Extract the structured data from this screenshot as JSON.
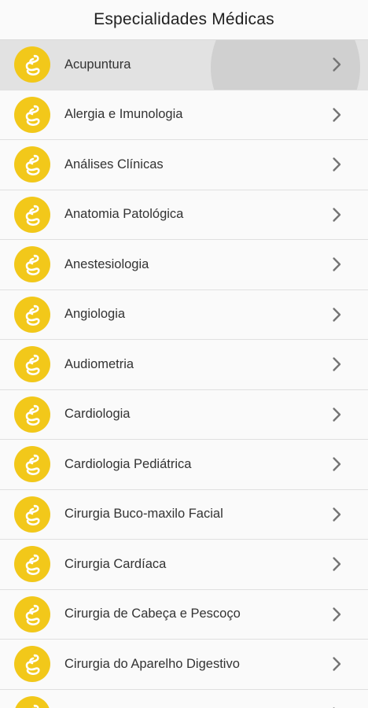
{
  "appbar": {
    "title": "Especialidades Médicas"
  },
  "colors": {
    "accent": "#f2c81a",
    "pressed_row": "#e2e2e2",
    "chevron": "#757575"
  },
  "icons": {
    "avatar": "snake-logo-icon",
    "trailing": "chevron-right-icon"
  },
  "list": {
    "items": [
      {
        "label": "Acupuntura"
      },
      {
        "label": "Alergia e Imunologia"
      },
      {
        "label": "Análises Clínicas"
      },
      {
        "label": "Anatomia Patológica"
      },
      {
        "label": "Anestesiologia"
      },
      {
        "label": "Angiologia"
      },
      {
        "label": "Audiometria"
      },
      {
        "label": "Cardiologia"
      },
      {
        "label": "Cardiologia Pediátrica"
      },
      {
        "label": "Cirurgia Buco-maxilo Facial"
      },
      {
        "label": "Cirurgia Cardíaca"
      },
      {
        "label": "Cirurgia de Cabeça e Pescoço"
      },
      {
        "label": "Cirurgia do Aparelho Digestivo"
      },
      {
        "label": ""
      }
    ]
  }
}
